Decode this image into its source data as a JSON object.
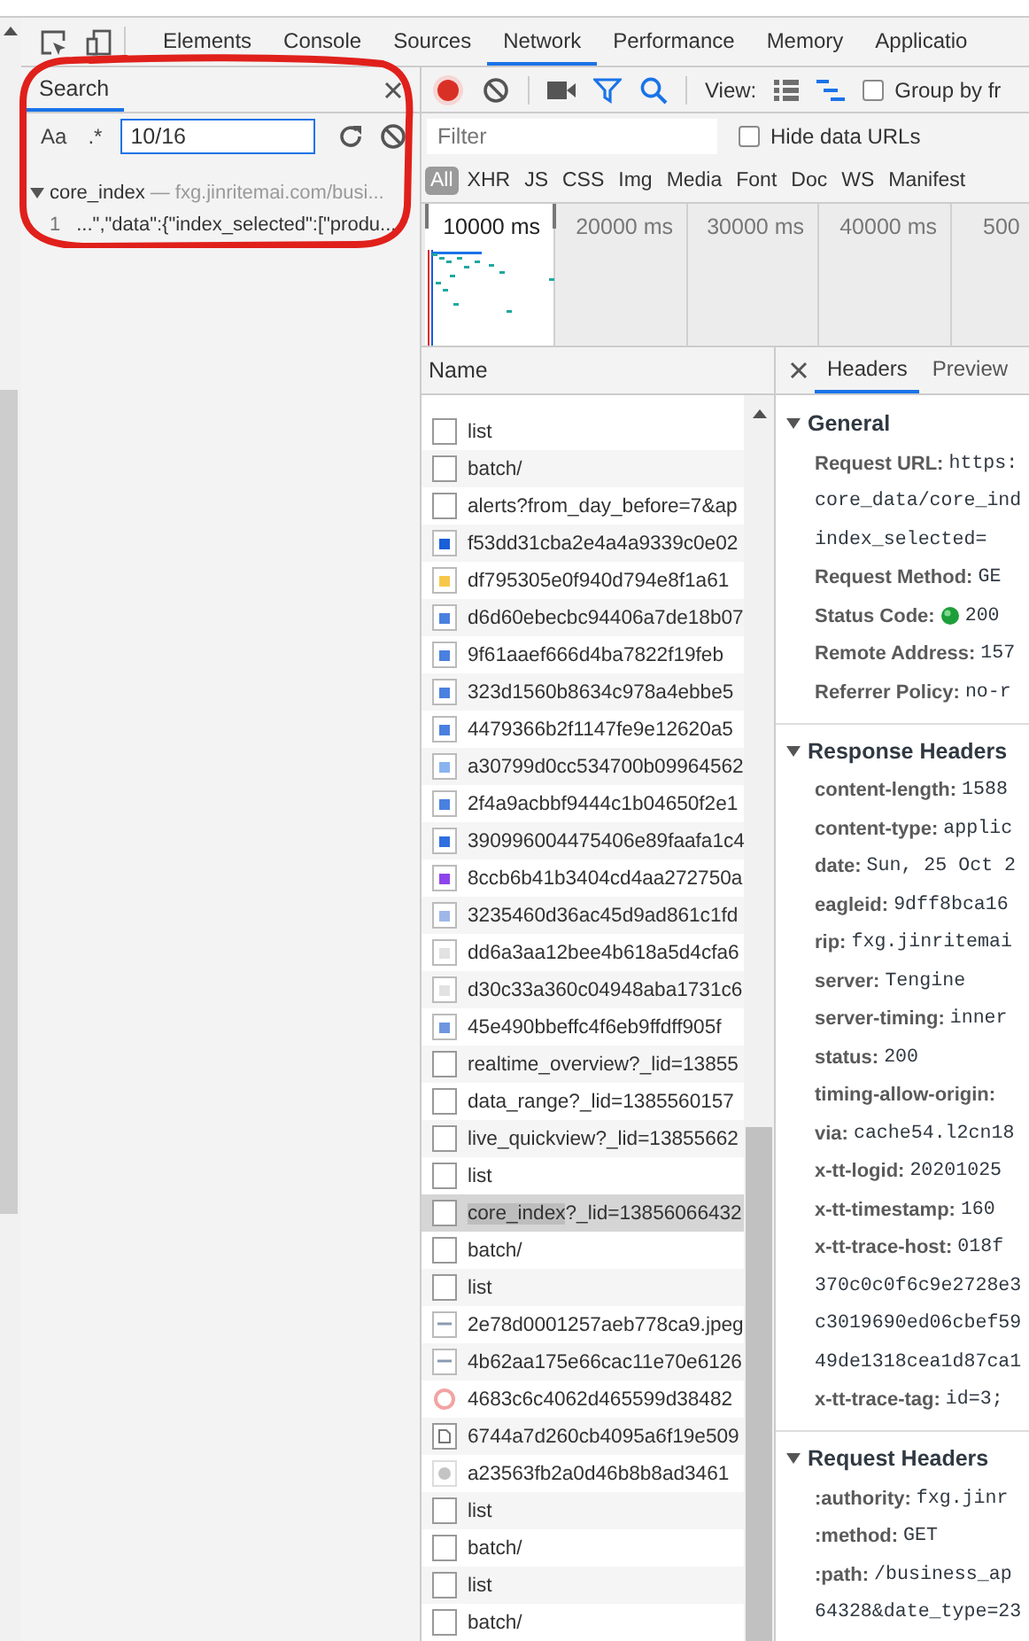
{
  "toolbar_tabs": [
    {
      "label": "Elements",
      "selected": false
    },
    {
      "label": "Console",
      "selected": false
    },
    {
      "label": "Sources",
      "selected": false
    },
    {
      "label": "Network",
      "selected": true
    },
    {
      "label": "Performance",
      "selected": false
    },
    {
      "label": "Memory",
      "selected": false
    },
    {
      "label": "Applicatio",
      "selected": false
    }
  ],
  "search_panel": {
    "tab": "Search",
    "case_toggle": "Aa",
    "regex_toggle": ".*",
    "query": "10/16",
    "results": [
      {
        "file": "core_index",
        "url": "— fxg.jinritemai.com/busi...",
        "expanded": true,
        "matches": [
          {
            "line": "1",
            "text": "...\",\"data\":{\"index_selected\":[\"produ..."
          }
        ]
      }
    ]
  },
  "network_toolbar": {
    "recording": true,
    "filter_shown": true,
    "search_shown": true,
    "large_rows": false,
    "overview_shown": true,
    "view_label": "View:",
    "group_by_frames": {
      "label": "Group by fr",
      "checked": false
    }
  },
  "filter": {
    "placeholder": "Filter",
    "hide_data_urls": {
      "label": "Hide data URLs",
      "checked": false
    }
  },
  "type_filters": [
    {
      "label": "All",
      "selected": true
    },
    {
      "label": "XHR",
      "selected": false
    },
    {
      "label": "JS",
      "selected": false
    },
    {
      "label": "CSS",
      "selected": false
    },
    {
      "label": "Img",
      "selected": false
    },
    {
      "label": "Media",
      "selected": false
    },
    {
      "label": "Font",
      "selected": false
    },
    {
      "label": "Doc",
      "selected": false
    },
    {
      "label": "WS",
      "selected": false
    },
    {
      "label": "Manifest",
      "selected": false
    }
  ],
  "timeline": {
    "ticks": [
      "10000 ms",
      "20000 ms",
      "30000 ms",
      "40000 ms",
      "500"
    ]
  },
  "requests": {
    "column": "Name",
    "rows": [
      {
        "kind": "doc",
        "name_parts": [
          {
            "text": "list",
            "highlighted": false
          }
        ],
        "selected": false
      },
      {
        "kind": "doc",
        "name_parts": [
          {
            "text": "batch/",
            "highlighted": false
          }
        ],
        "selected": false
      },
      {
        "kind": "doc",
        "name_parts": [
          {
            "text": "alerts?from_day_before=7&ap",
            "highlighted": false
          }
        ],
        "selected": false
      },
      {
        "kind": "image",
        "color": "#1a5fd8",
        "name_parts": [
          {
            "text": "f53dd31cba2e4a4a9339c0e02",
            "highlighted": false
          }
        ],
        "selected": false
      },
      {
        "kind": "image",
        "color": "#f6c84a",
        "name_parts": [
          {
            "text": "df795305e0f940d794e8f1a61",
            "highlighted": false
          }
        ],
        "selected": false
      },
      {
        "kind": "image",
        "color": "#4a80e0",
        "name_parts": [
          {
            "text": "d6d60ebecbc94406a7de18b07",
            "highlighted": false
          }
        ],
        "selected": false
      },
      {
        "kind": "image",
        "color": "#4a80e0",
        "name_parts": [
          {
            "text": "9f61aaef666d4ba7822f19feb",
            "highlighted": false
          }
        ],
        "selected": false
      },
      {
        "kind": "image",
        "color": "#4a80e0",
        "name_parts": [
          {
            "text": "323d1560b8634c978a4ebbe5",
            "highlighted": false
          }
        ],
        "selected": false
      },
      {
        "kind": "image",
        "color": "#4a80e0",
        "name_parts": [
          {
            "text": "4479366b2f1147fe9e12620a5",
            "highlighted": false
          }
        ],
        "selected": false
      },
      {
        "kind": "image",
        "color": "#8ab4f0",
        "name_parts": [
          {
            "text": "a30799d0cc534700b09964562",
            "highlighted": false
          }
        ],
        "selected": false
      },
      {
        "kind": "image",
        "color": "#4a80e0",
        "name_parts": [
          {
            "text": "2f4a9acbbf9444c1b04650f2e1",
            "highlighted": false
          }
        ],
        "selected": false
      },
      {
        "kind": "image",
        "color": "#2f6fe0",
        "name_parts": [
          {
            "text": "390996004475406e89faafa1c4",
            "highlighted": false
          }
        ],
        "selected": false
      },
      {
        "kind": "image",
        "color": "#8e44ec",
        "name_parts": [
          {
            "text": "8ccb6b41b3404cd4aa272750a",
            "highlighted": false
          }
        ],
        "selected": false
      },
      {
        "kind": "image",
        "color": "#9fb6e8",
        "name_parts": [
          {
            "text": "3235460d36ac45d9ad861c1fd",
            "highlighted": false
          }
        ],
        "selected": false
      },
      {
        "kind": "image",
        "color": "#e2e2e2",
        "name_parts": [
          {
            "text": "dd6a3aa12bee4b618a5d4cfa6",
            "highlighted": false
          }
        ],
        "selected": false
      },
      {
        "kind": "image",
        "color": "#e2e2e2",
        "name_parts": [
          {
            "text": "d30c33a360c04948aba1731c6",
            "highlighted": false
          }
        ],
        "selected": false
      },
      {
        "kind": "image",
        "color": "#6f95e0",
        "name_parts": [
          {
            "text": "45e490bbeffc4f6eb9ffdff905f",
            "highlighted": false
          }
        ],
        "selected": false
      },
      {
        "kind": "doc",
        "name_parts": [
          {
            "text": "realtime_overview?_lid=13855",
            "highlighted": false
          }
        ],
        "selected": false
      },
      {
        "kind": "doc",
        "name_parts": [
          {
            "text": "data_range?_lid=1385560157",
            "highlighted": false
          }
        ],
        "selected": false
      },
      {
        "kind": "doc",
        "name_parts": [
          {
            "text": "live_quickview?_lid=13855662",
            "highlighted": false
          }
        ],
        "selected": false
      },
      {
        "kind": "doc",
        "name_parts": [
          {
            "text": "list",
            "highlighted": false
          }
        ],
        "selected": false
      },
      {
        "kind": "doc",
        "name_parts": [
          {
            "text": "core_index",
            "highlighted": true
          },
          {
            "text": "?_lid=13856066432",
            "highlighted": false
          }
        ],
        "selected": true
      },
      {
        "kind": "doc",
        "name_parts": [
          {
            "text": "batch/",
            "highlighted": false
          }
        ],
        "selected": false
      },
      {
        "kind": "doc",
        "name_parts": [
          {
            "text": "list",
            "highlighted": false
          }
        ],
        "selected": false
      },
      {
        "kind": "jpeg",
        "name_parts": [
          {
            "text": "2e78d0001257aeb778ca9.jpeg",
            "highlighted": false
          }
        ],
        "selected": false
      },
      {
        "kind": "jpeg",
        "name_parts": [
          {
            "text": "4b62aa175e66cac11e70e6126",
            "highlighted": false
          }
        ],
        "selected": false
      },
      {
        "kind": "ring",
        "color": "#f2a3a3",
        "name_parts": [
          {
            "text": "4683c6c4062d465599d38482",
            "highlighted": false
          }
        ],
        "selected": false
      },
      {
        "kind": "file",
        "name_parts": [
          {
            "text": "6744a7d260cb4095a6f19e509",
            "highlighted": false
          }
        ],
        "selected": false
      },
      {
        "kind": "dot",
        "color": "#c4c4c4",
        "name_parts": [
          {
            "text": "a23563fb2a0d46b8b8ad3461",
            "highlighted": false
          }
        ],
        "selected": false
      },
      {
        "kind": "doc",
        "name_parts": [
          {
            "text": "list",
            "highlighted": false
          }
        ],
        "selected": false
      },
      {
        "kind": "doc",
        "name_parts": [
          {
            "text": "batch/",
            "highlighted": false
          }
        ],
        "selected": false
      },
      {
        "kind": "doc",
        "name_parts": [
          {
            "text": "list",
            "highlighted": false
          }
        ],
        "selected": false
      },
      {
        "kind": "doc",
        "name_parts": [
          {
            "text": "batch/",
            "highlighted": false
          }
        ],
        "selected": false
      }
    ]
  },
  "details": {
    "tabs": [
      {
        "label": "Headers",
        "selected": true
      },
      {
        "label": "Preview",
        "selected": false
      }
    ],
    "sections": [
      {
        "title": "General",
        "expanded": true,
        "rows": [
          {
            "key": "Request URL:",
            "value": "https:"
          },
          {
            "value": "core_data/core_ind"
          },
          {
            "value": "index_selected="
          },
          {
            "key": "Request Method:",
            "value": "GE"
          },
          {
            "key": "Status Code:",
            "kind": "status",
            "value": "200"
          },
          {
            "key": "Remote Address:",
            "value": "157"
          },
          {
            "key": "Referrer Policy:",
            "value": "no-r"
          }
        ]
      },
      {
        "title": "Response Headers",
        "expanded": true,
        "rows": [
          {
            "key": "content-length:",
            "value": "1588"
          },
          {
            "key": "content-type:",
            "value": "applic"
          },
          {
            "key": "date:",
            "value": "Sun, 25 Oct 2"
          },
          {
            "key": "eagleid:",
            "value": "9dff8bca16"
          },
          {
            "key": "rip:",
            "value": "fxg.jinritemai"
          },
          {
            "key": "server:",
            "value": "Tengine"
          },
          {
            "key": "server-timing:",
            "value": "inner"
          },
          {
            "key": "status:",
            "value": "200"
          },
          {
            "key": "timing-allow-origin:"
          },
          {
            "key": "via:",
            "value": "cache54.l2cn18"
          },
          {
            "key": "x-tt-logid:",
            "value": "20201025"
          },
          {
            "key": "x-tt-timestamp:",
            "value": "160"
          },
          {
            "key": "x-tt-trace-host:",
            "value": "018f"
          },
          {
            "value": "370c0c0f6c9e2728e3"
          },
          {
            "value": "c3019690ed06cbef59"
          },
          {
            "value": "49de1318cea1d87ca1"
          },
          {
            "key": "x-tt-trace-tag:",
            "value": "id=3;"
          }
        ]
      },
      {
        "title": "Request Headers",
        "expanded": true,
        "rows": [
          {
            "key": ":authority:",
            "value": "fxg.jinr"
          },
          {
            "key": ":method:",
            "value": "GET"
          },
          {
            "key": ":path:",
            "value": "/business_ap"
          },
          {
            "value": "64328&date_type=23"
          }
        ]
      }
    ]
  }
}
